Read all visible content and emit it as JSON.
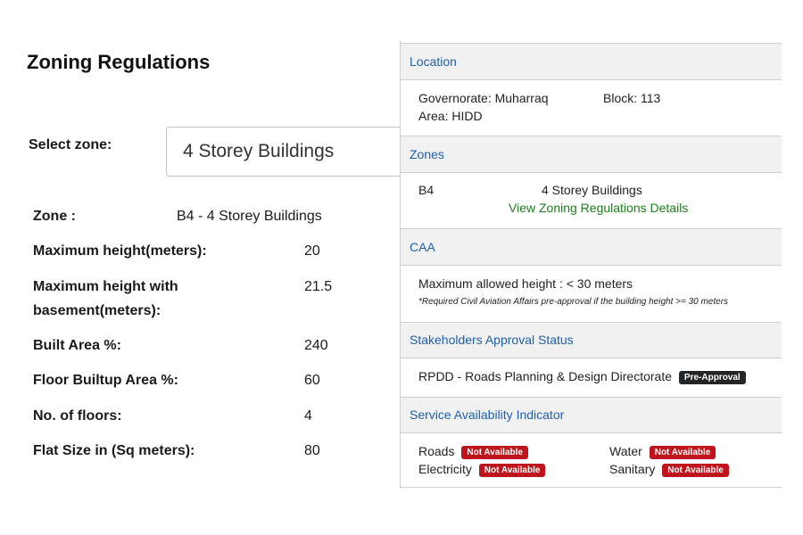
{
  "header": {
    "title": "Zoning Regulations"
  },
  "zone_select": {
    "label": "Select zone:",
    "value": "4 Storey Buildings"
  },
  "regulations": [
    {
      "label": "Zone :",
      "value": "B4 - 4 Storey Buildings"
    },
    {
      "label": "Maximum height(meters):",
      "value": "20"
    },
    {
      "label": "Maximum height with",
      "label2": "basement(meters):",
      "value": "21.5"
    },
    {
      "label": "Built Area %:",
      "value": "240"
    },
    {
      "label": "Floor Builtup Area %:",
      "value": "60"
    },
    {
      "label": "No. of floors:",
      "value": "4"
    },
    {
      "label": "Flat Size in (Sq meters):",
      "value": "80"
    }
  ],
  "location": {
    "title": "Location",
    "governorate": "Governorate: Muharraq",
    "block": "Block: 113",
    "area": "Area: HIDD"
  },
  "zones": {
    "title": "Zones",
    "code": "B4",
    "name": "4 Storey Buildings",
    "link": "View Zoning Regulations Details"
  },
  "caa": {
    "title": "CAA",
    "max_height": "Maximum allowed height : < 30 meters",
    "note": "*Required Civil Aviation Affairs pre-approval if the building height >= 30 meters"
  },
  "stakeholders": {
    "title": "Stakeholders Approval Status",
    "name": "RPDD - Roads Planning & Design Directorate",
    "badge": "Pre-Approval"
  },
  "services": {
    "title": "Service Availability Indicator",
    "items": [
      {
        "name": "Roads",
        "status": "Not Available"
      },
      {
        "name": "Water",
        "status": "Not Available"
      },
      {
        "name": "Electricity",
        "status": "Not Available"
      },
      {
        "name": "Sanitary",
        "status": "Not Available"
      }
    ]
  },
  "colors": {
    "link_blue": "#1f5fae",
    "link_green": "#1d7d1d",
    "badge_red": "#c0141c",
    "badge_dark": "#222629"
  }
}
